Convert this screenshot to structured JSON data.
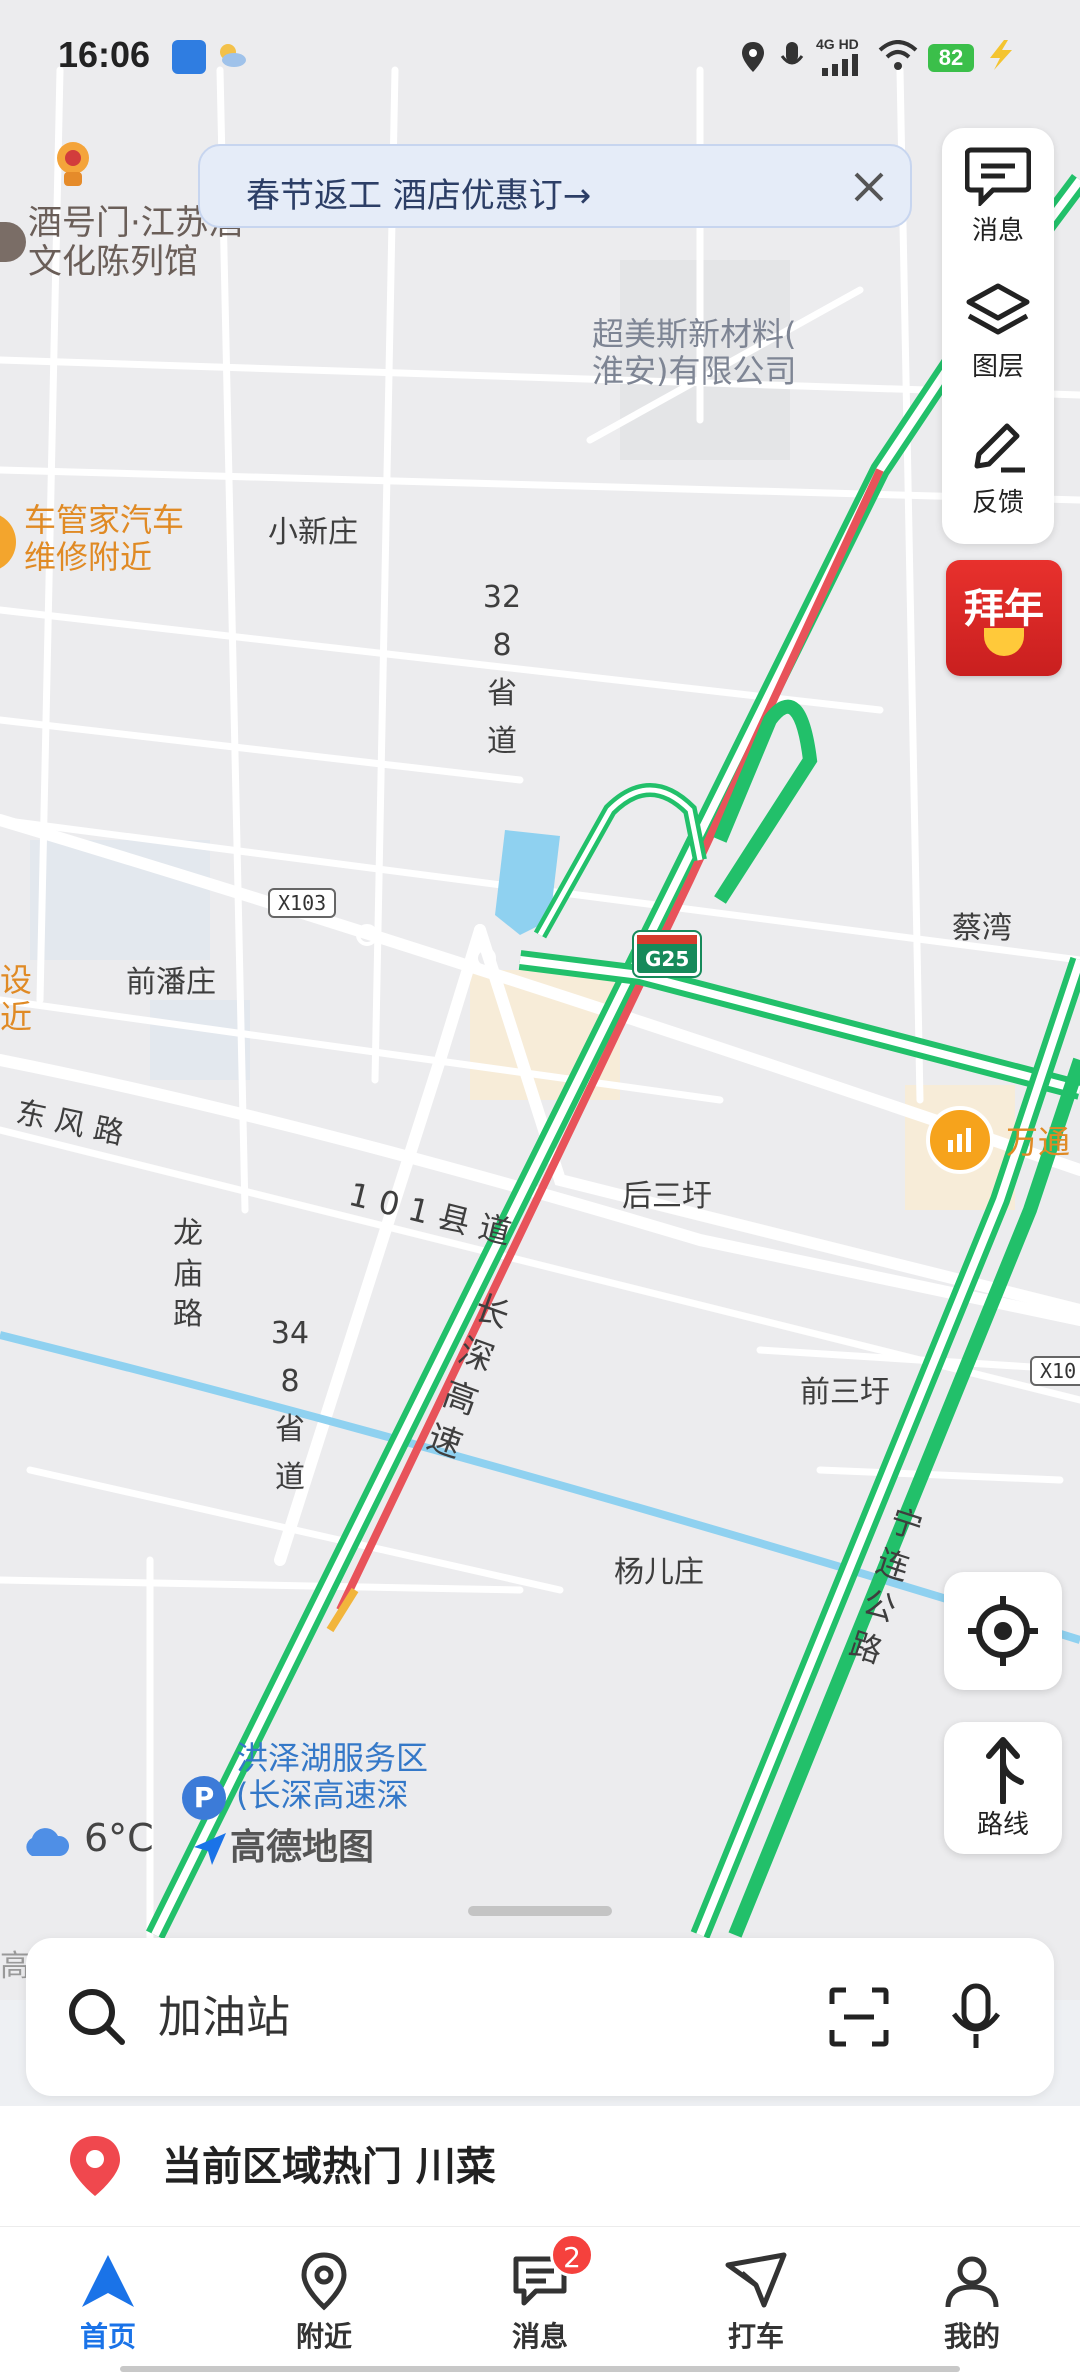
{
  "status": {
    "time": "16:06",
    "battery": "82",
    "network": "4G HD"
  },
  "promo": {
    "text": "春节返工 酒店优惠订→"
  },
  "tools": {
    "messages": "消息",
    "layers": "图层",
    "feedback": "反馈",
    "festival": "拜年"
  },
  "map": {
    "labels": {
      "museum": "酒号门·江苏酒\n文化陈列馆",
      "company": "超美斯新材料(\n淮安)有限公司",
      "carrepair": "车管家汽车\n维修附近",
      "xiaoxinzhuang": "小新庄",
      "provincial328": "328省道",
      "x103": "X103",
      "g25": "G25",
      "caiwan": "蔡湾",
      "qianpanzhuang": "前潘庄",
      "she": "设\n近",
      "dongfeng": "东 风 路",
      "wantong": "万通",
      "county101": "1 0 1 县 道",
      "housanyu": "后三圩",
      "longmiao": "龙\n庙\n路",
      "changshen": "长\n深\n高\n速",
      "provincial348": "348省道",
      "x10": "X10",
      "qiansanyu": "前三圩",
      "ninglian": "宁\n连\n公\n路",
      "yangerzhuang": "杨儿庄",
      "service_area": "洪泽湖服务区\n(长深高速深",
      "gao": "高"
    }
  },
  "controls": {
    "route": "路线"
  },
  "weather": {
    "temp": "6°C"
  },
  "brand": {
    "logo_text": "高德地图"
  },
  "search": {
    "placeholder": "加油站"
  },
  "hot": {
    "text": "当前区域热门 川菜"
  },
  "tabs": [
    {
      "label": "首页",
      "icon": "home-arrow-icon"
    },
    {
      "label": "附近",
      "icon": "location-pin-icon"
    },
    {
      "label": "消息",
      "icon": "message-icon",
      "badge": "2"
    },
    {
      "label": "打车",
      "icon": "taxi-icon"
    },
    {
      "label": "我的",
      "icon": "user-icon"
    }
  ],
  "colors": {
    "accent": "#1a73e8",
    "traffic_green": "#22c06a",
    "traffic_red": "#e8535a",
    "water": "#8fd1f0"
  }
}
